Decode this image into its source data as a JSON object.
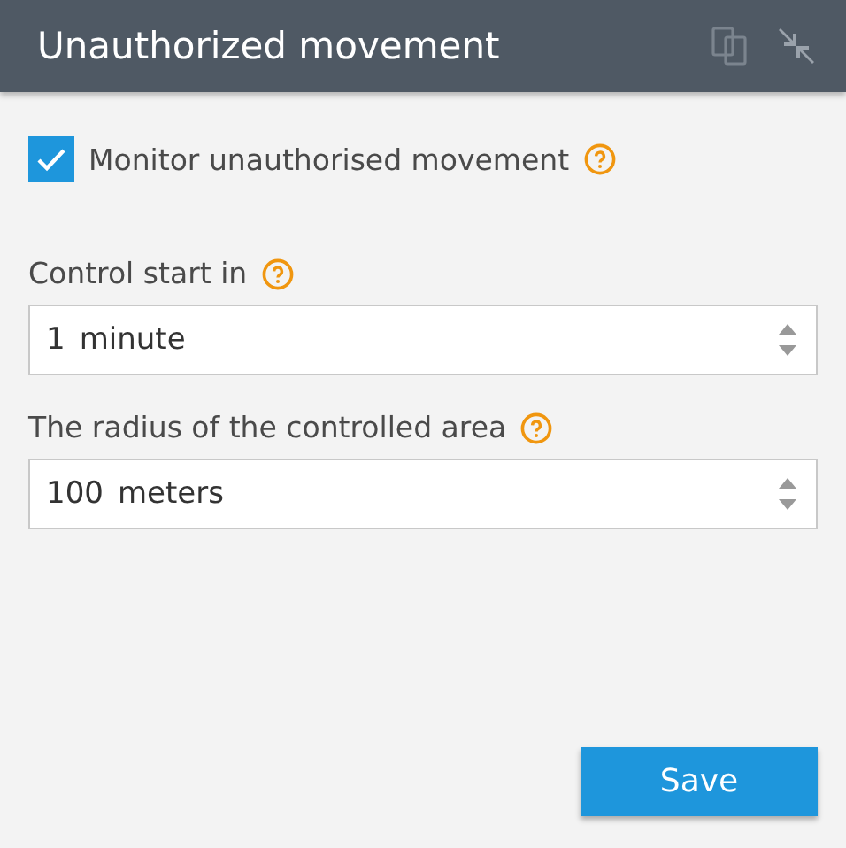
{
  "window": {
    "title": "Unauthorized movement"
  },
  "monitor": {
    "label": "Monitor unauthorised movement",
    "checked": true
  },
  "fields": [
    {
      "label": "Control start in",
      "value": "1",
      "unit": "minute"
    },
    {
      "label": "The radius of the controlled area",
      "value": "100",
      "unit": "meters"
    }
  ],
  "buttons": [
    "Save"
  ]
}
